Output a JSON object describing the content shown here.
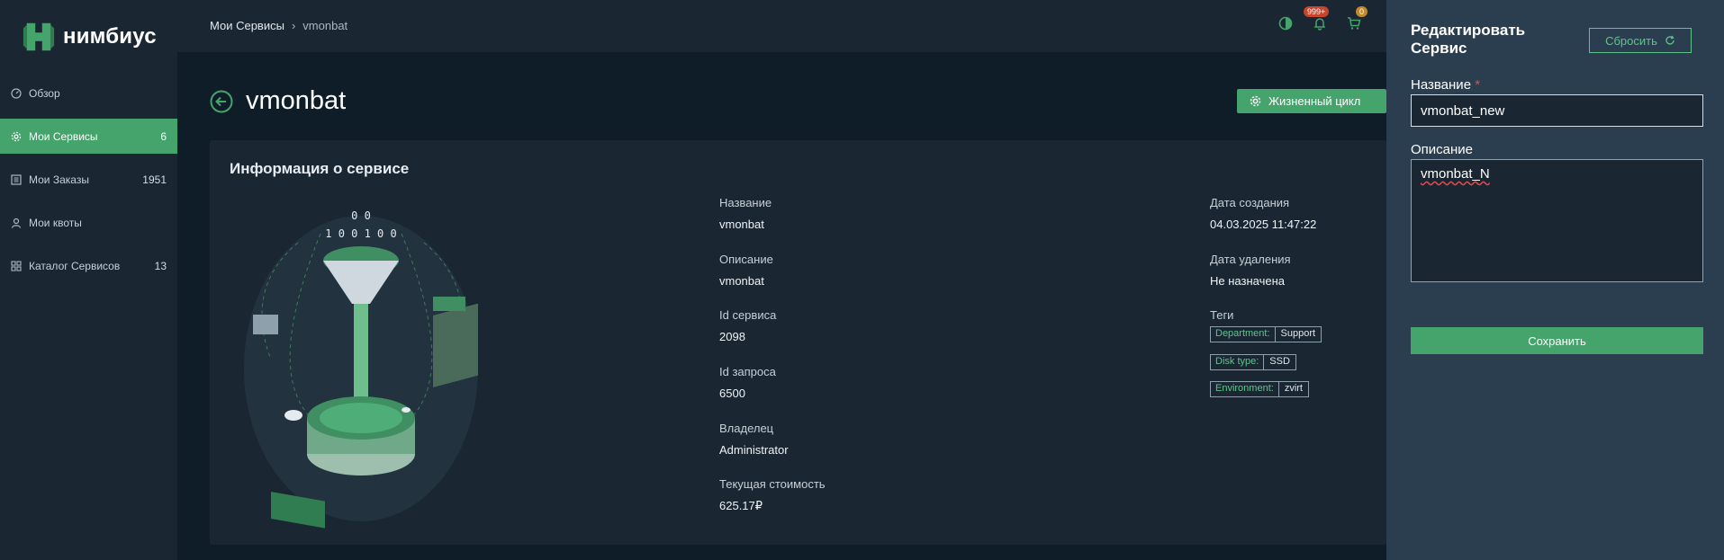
{
  "app": {
    "logo_text": "нимбиус"
  },
  "sidebar": {
    "items": [
      {
        "label": "Обзор",
        "count": ""
      },
      {
        "label": "Мои Сервисы",
        "count": "6"
      },
      {
        "label": "Мои Заказы",
        "count": "1951"
      },
      {
        "label": "Мои квоты",
        "count": ""
      },
      {
        "label": "Каталог Сервисов",
        "count": "13"
      }
    ]
  },
  "breadcrumb": {
    "root": "Мои Сервисы",
    "separator": "›",
    "current": "vmonbat"
  },
  "topbar": {
    "notifications_badge": "999+",
    "cart_badge": "0"
  },
  "header": {
    "title": "vmonbat",
    "lifecycle_label": "Жизненный цикл"
  },
  "card": {
    "title": "Информация о сервисе",
    "fields_left": [
      {
        "label": "Название",
        "value": "vmonbat"
      },
      {
        "label": "Описание",
        "value": "vmonbat"
      },
      {
        "label": "Id сервиса",
        "value": "2098"
      },
      {
        "label": "Id запроса",
        "value": "6500"
      },
      {
        "label": "Владелец",
        "value": "Administrator"
      },
      {
        "label": "Текущая стоимость",
        "value": "625.17₽"
      }
    ],
    "fields_right": [
      {
        "label": "Дата создания",
        "value": "04.03.2025 11:47:22"
      },
      {
        "label": "Дата удаления",
        "value": "Не назначена"
      }
    ],
    "tags_label": "Теги",
    "tags": [
      {
        "key": "Department:",
        "value": "Support"
      },
      {
        "key": "Disk type:",
        "value": "SSD"
      },
      {
        "key": "Environment:",
        "value": "zvirt"
      }
    ]
  },
  "panel": {
    "title": "Редактировать Сервис",
    "reset_label": "Сбросить",
    "name_label": "Название",
    "required_mark": "*",
    "name_value": "vmonbat_new",
    "description_label": "Описание",
    "description_value": "vmonbat_N",
    "save_label": "Сохранить"
  },
  "colors": {
    "accent": "#45a36c",
    "accent_text": "#5fc48b",
    "panel_bg": "#2b3e4f",
    "sidebar_bg": "#1a2733",
    "page_bg": "#0f1d29"
  }
}
